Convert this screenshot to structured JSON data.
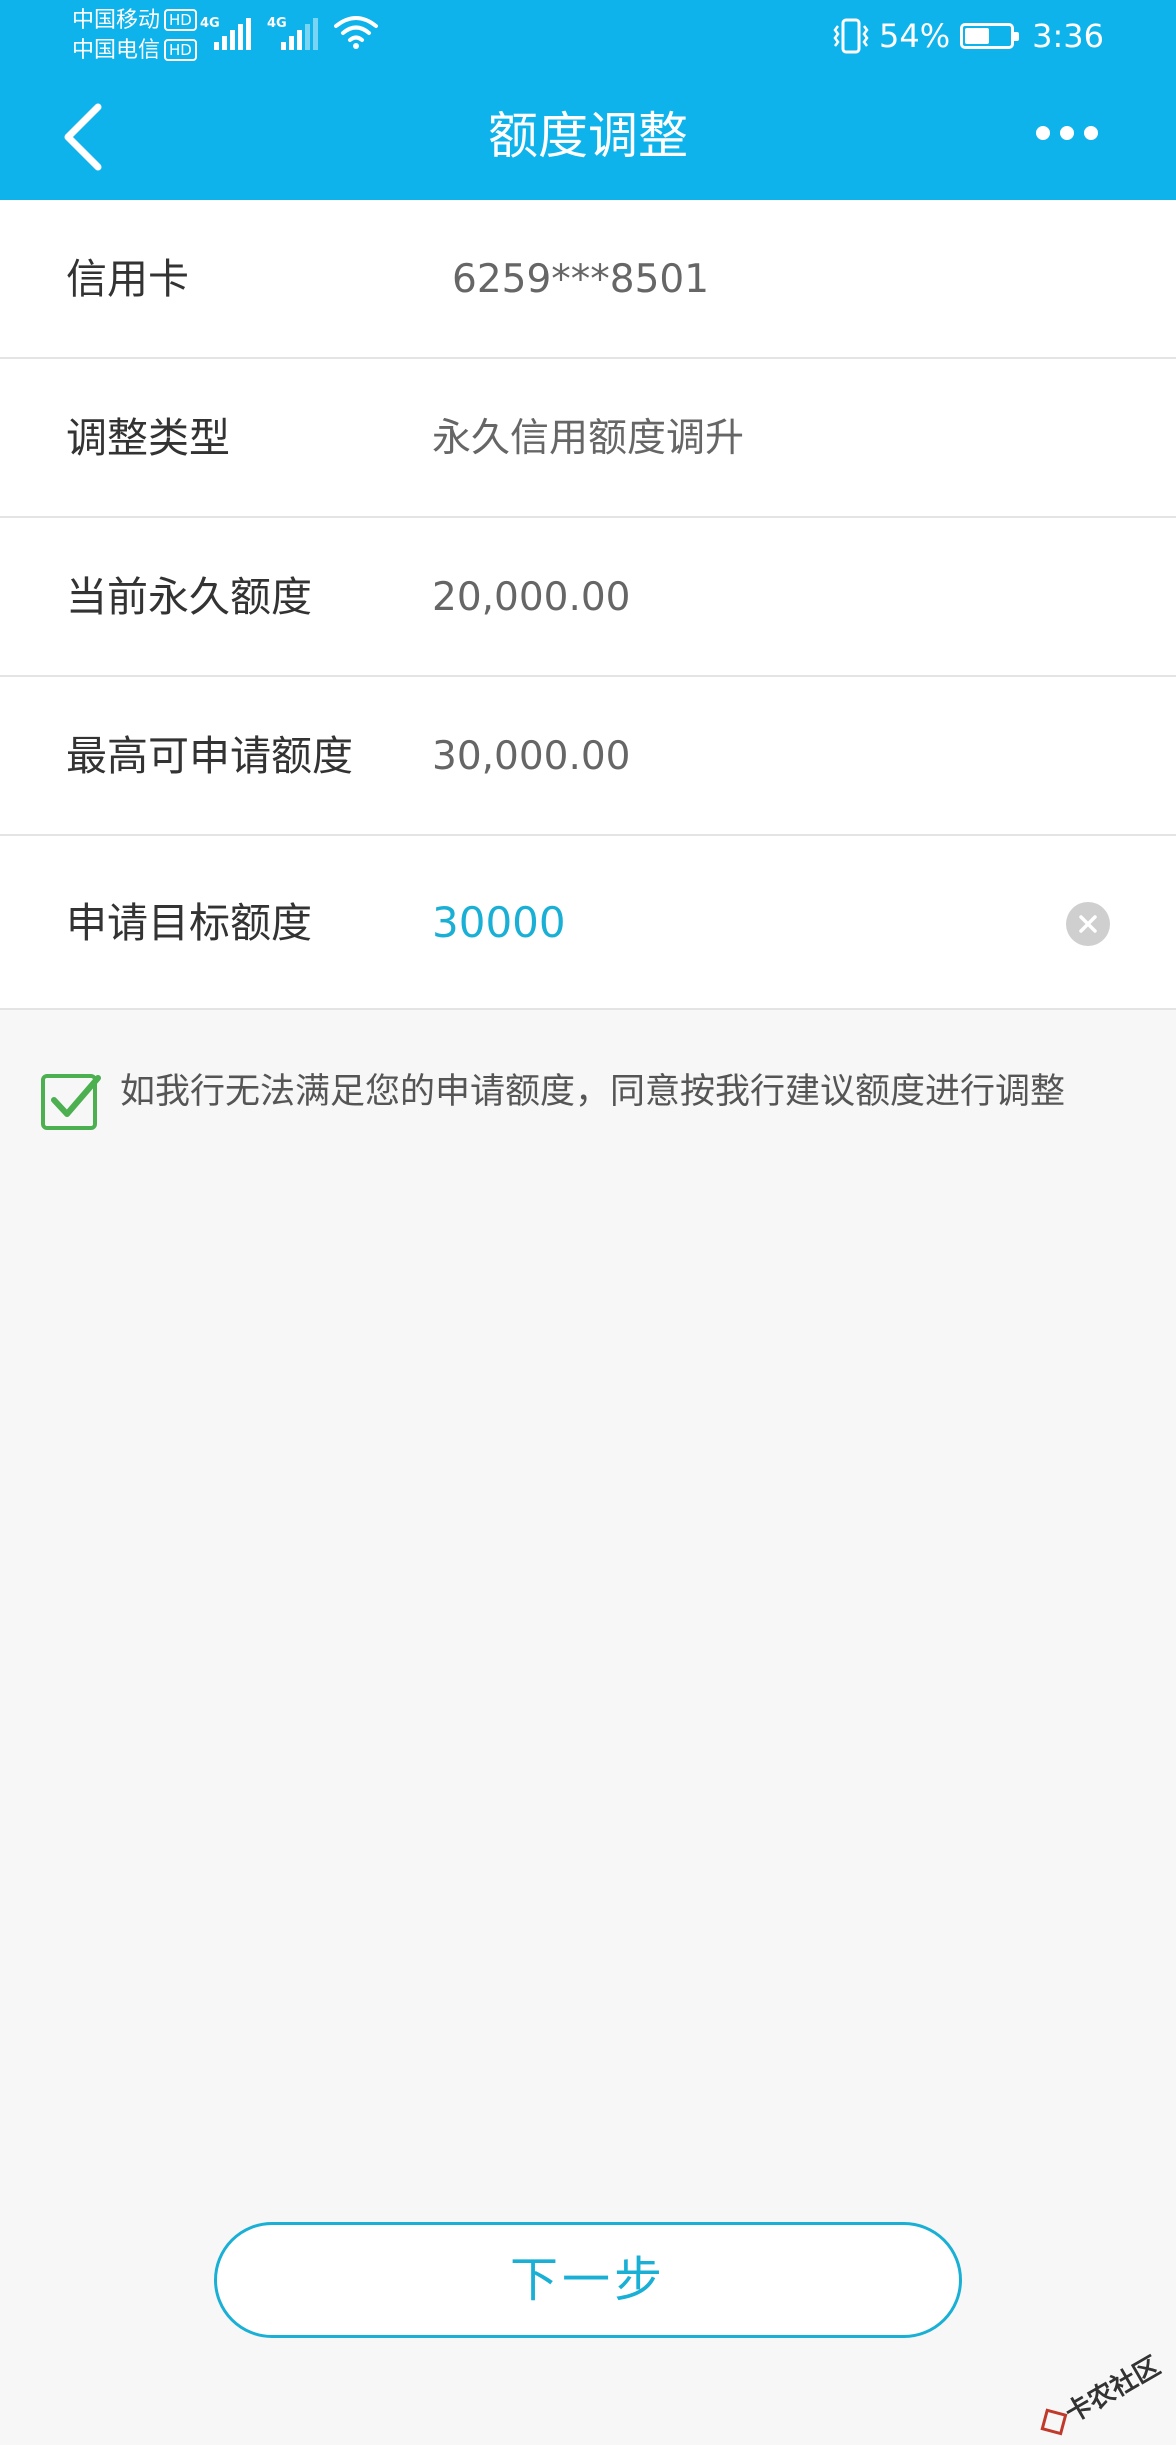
{
  "status_bar": {
    "carrier_1": "中国移动",
    "carrier_2": "中国电信",
    "hd_badge": "HD",
    "network_1": "4G",
    "network_2": "4G",
    "battery_text": "54%",
    "battery_level": 0.54,
    "time": "3:36"
  },
  "header": {
    "title": "额度调整"
  },
  "form": {
    "card_label": "信用卡",
    "card_value": "6259***8501",
    "type_label": "调整类型",
    "type_value": "永久信用额度调升",
    "current_label": "当前永久额度",
    "current_value": "20,000.00",
    "max_label": "最高可申请额度",
    "max_value": "30,000.00",
    "target_label": "申请目标额度",
    "target_value": "30000"
  },
  "agreement": {
    "text": "如我行无法满足您的申请额度，同意按我行建议额度进行调整",
    "checked": true
  },
  "footer": {
    "next_label": "下一步"
  },
  "watermark": {
    "text": "卡农社区"
  },
  "colors": {
    "brand": "#0eb3eb",
    "accent": "#1ab0d6",
    "check": "#4caf50"
  }
}
